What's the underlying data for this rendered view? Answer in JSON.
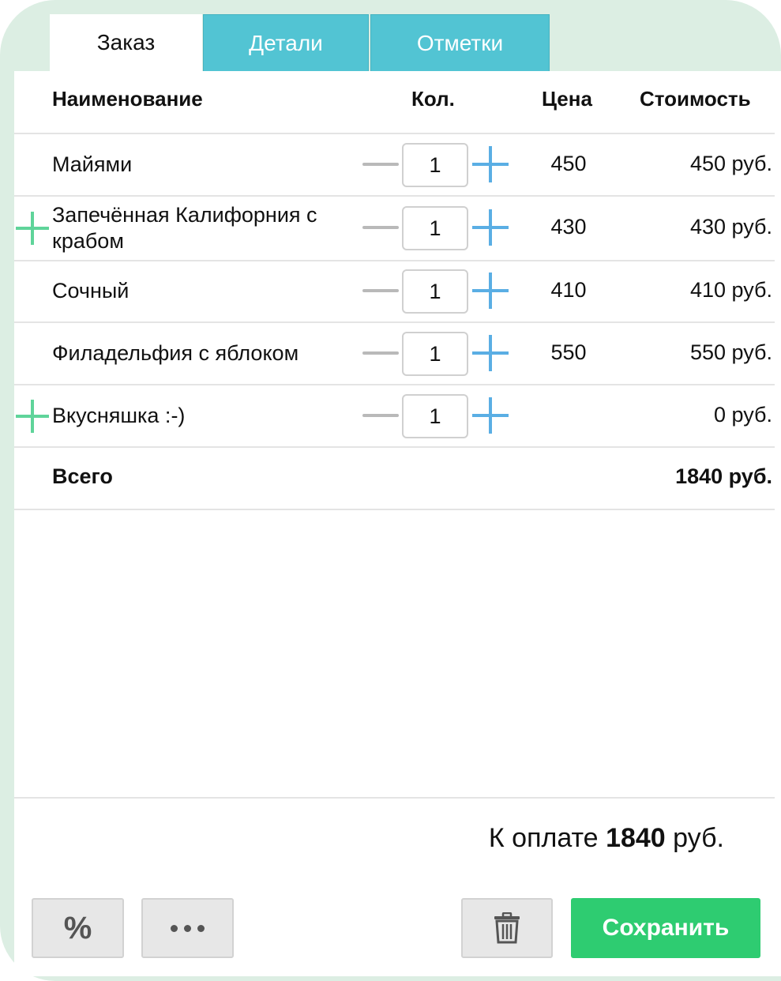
{
  "tabs": [
    {
      "label": "Заказ",
      "active": true
    },
    {
      "label": "Детали",
      "active": false
    },
    {
      "label": "Отметки",
      "active": false
    }
  ],
  "table": {
    "headers": {
      "name": "Наименование",
      "qty": "Кол.",
      "price": "Цена",
      "sum": "Стоимость"
    },
    "rows": [
      {
        "name": "Майями",
        "qty": "1",
        "price": "450",
        "sum": "450 руб.",
        "has_add": false
      },
      {
        "name": "Запечённая Калифорния с крабом",
        "qty": "1",
        "price": "430",
        "sum": "430 руб.",
        "has_add": true
      },
      {
        "name": "Сочный",
        "qty": "1",
        "price": "410",
        "sum": "410 руб.",
        "has_add": false
      },
      {
        "name": "Филадельфия с яблоком",
        "qty": "1",
        "price": "550",
        "sum": "550 руб.",
        "has_add": false
      },
      {
        "name": "Вкусняшка :-)",
        "qty": "1",
        "price": "",
        "sum": "0 руб.",
        "has_add": true
      }
    ],
    "total_label": "Всего",
    "total_value": "1840 руб."
  },
  "footer": {
    "to_pay_prefix": "К оплате",
    "to_pay_amount": "1840",
    "to_pay_suffix": "руб."
  },
  "buttons": {
    "discount": "%",
    "more": "more-dots-icon",
    "delete": "trash-icon",
    "save": "Сохранить"
  },
  "colors": {
    "frame_bg": "#dceee3",
    "tab_inactive": "#52c4d3",
    "plus_blue": "#5aaee4",
    "add_green": "#5fd49a",
    "save_green": "#2ecc71"
  }
}
